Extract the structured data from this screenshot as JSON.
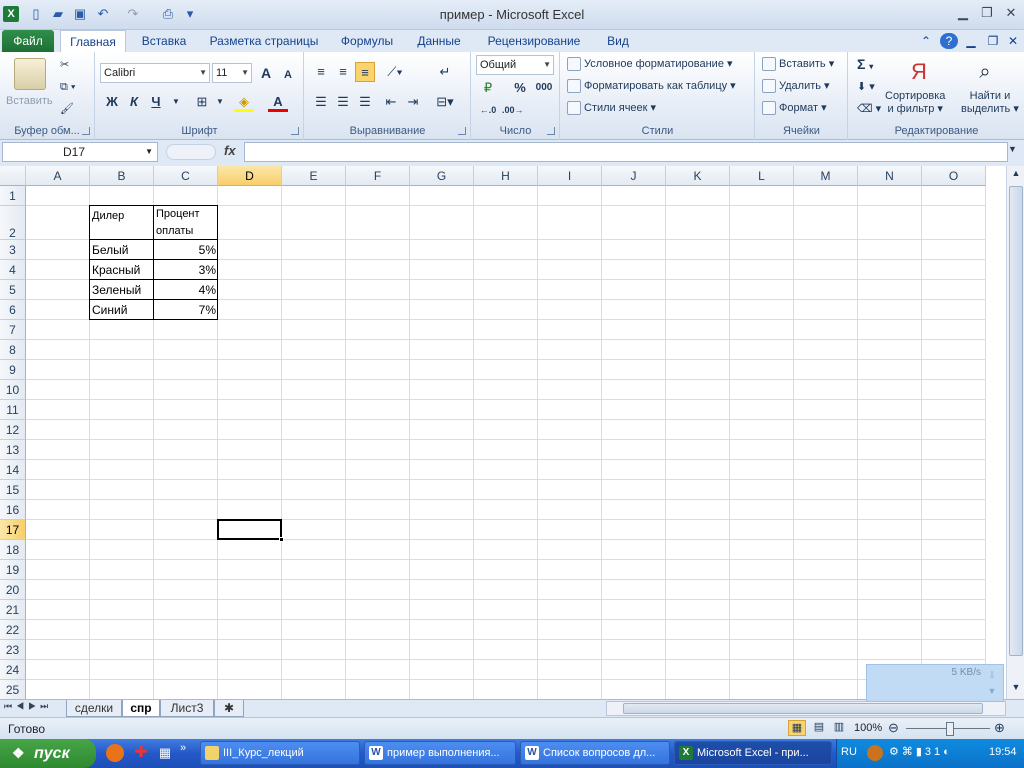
{
  "window": {
    "title": "пример - Microsoft Excel"
  },
  "tabs": [
    {
      "label": "Файл"
    },
    {
      "label": "Главная"
    },
    {
      "label": "Вставка"
    },
    {
      "label": "Разметка страницы"
    },
    {
      "label": "Формулы"
    },
    {
      "label": "Данные"
    },
    {
      "label": "Рецензирование"
    },
    {
      "label": "Вид"
    }
  ],
  "ribbon": {
    "clipboard": {
      "label": "Буфер обм...",
      "paste": "Вставить"
    },
    "font": {
      "label": "Шрифт",
      "name": "Calibri",
      "size": "11",
      "bold": "Ж",
      "italic": "К",
      "underline": "Ч",
      "grow": "A",
      "shrink": "A",
      "fontcolor": "A"
    },
    "alignment": {
      "label": "Выравнивание"
    },
    "number": {
      "label": "Число",
      "format": "Общий",
      "percent": "%",
      "thousands": "000"
    },
    "styles": {
      "label": "Стили",
      "conditional": "Условное форматирование",
      "as_table": "Форматировать как таблицу",
      "cell_styles": "Стили ячеек"
    },
    "cells": {
      "label": "Ячейки",
      "insert": "Вставить",
      "delete": "Удалить",
      "format": "Формат"
    },
    "editing": {
      "label": "Редактирование",
      "sigma": "Σ",
      "sort": "Сортировка",
      "sort2": "и фильтр",
      "find": "Найти и",
      "find2": "выделить"
    }
  },
  "formula_bar": {
    "name_box": "D17",
    "fx": "fx",
    "value": ""
  },
  "columns": [
    "A",
    "B",
    "C",
    "D",
    "E",
    "F",
    "G",
    "H",
    "I",
    "J",
    "K",
    "L",
    "M",
    "N",
    "O"
  ],
  "rows": [
    "1",
    "2",
    "3",
    "4",
    "5",
    "6",
    "7",
    "8",
    "9",
    "10",
    "11",
    "12",
    "13",
    "14",
    "15",
    "16",
    "17",
    "18",
    "19",
    "20",
    "21",
    "22",
    "23",
    "24",
    "25"
  ],
  "selected": {
    "col": "D",
    "row": "17"
  },
  "table": {
    "header_dealer": "Дилер",
    "header_pct_1": "Процент",
    "header_pct_2": "оплаты",
    "rows": [
      {
        "dealer": "Белый",
        "pct": "5%"
      },
      {
        "dealer": "Красный",
        "pct": "3%"
      },
      {
        "dealer": "Зеленый",
        "pct": "4%"
      },
      {
        "dealer": "Синий",
        "pct": "7%"
      }
    ]
  },
  "sheets": [
    {
      "label": "сделки"
    },
    {
      "label": "спр"
    },
    {
      "label": "Лист3"
    }
  ],
  "status": {
    "ready": "Готово",
    "zoom": "100%"
  },
  "taskbar": {
    "start": "пуск",
    "tasks": [
      {
        "label": "III_Курс_лекций"
      },
      {
        "label": "пример выполнения..."
      },
      {
        "label": "Список вопросов дл..."
      },
      {
        "label": "Microsoft Excel - при..."
      }
    ],
    "lang": "RU",
    "clock": "19:54"
  },
  "net_widget": {
    "speed": "5 KB/s"
  }
}
